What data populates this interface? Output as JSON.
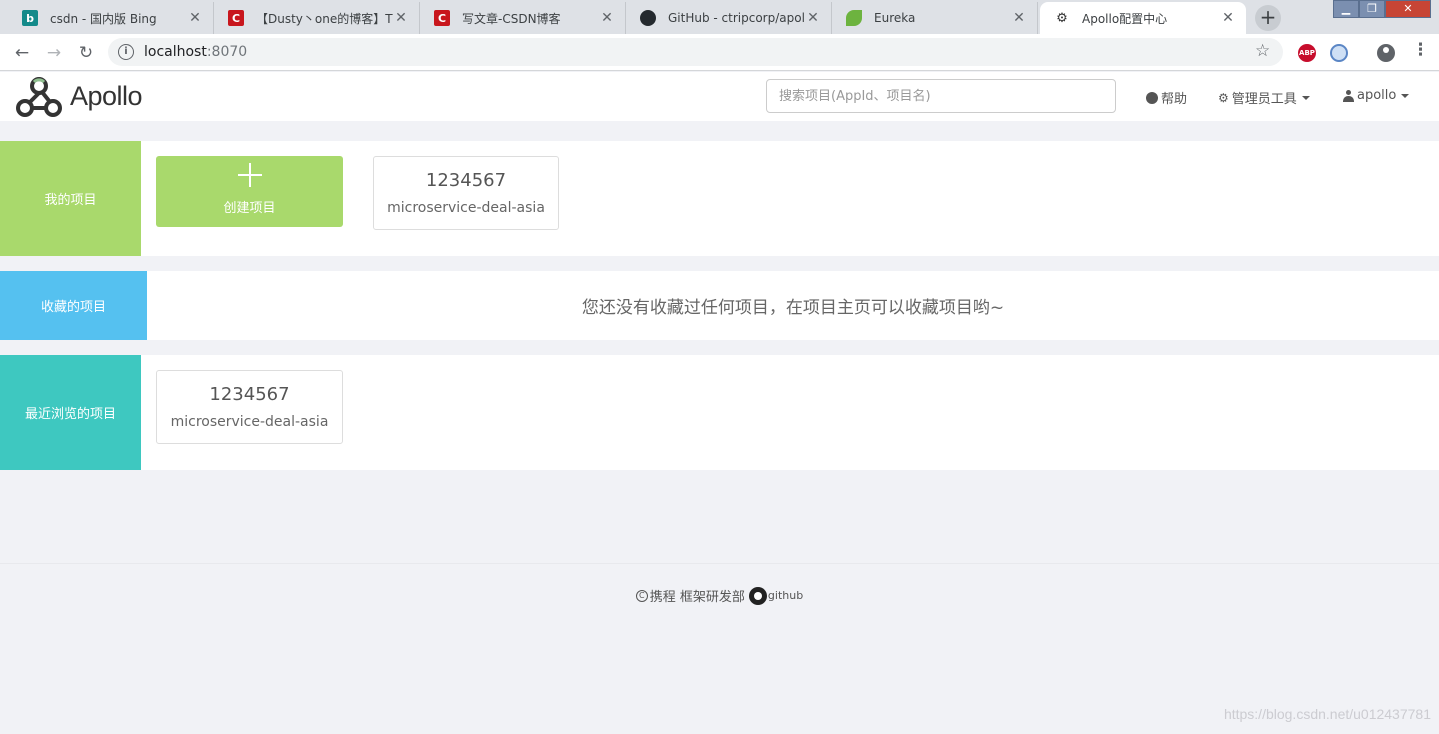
{
  "browser": {
    "tabs": [
      {
        "title": "csdn - 国内版 Bing",
        "icon": "bing-icon",
        "color": "#138a8a"
      },
      {
        "title": "【Dusty丶one的博客】Th",
        "icon": "csdn-icon",
        "color": "#c8161d"
      },
      {
        "title": "写文章-CSDN博客",
        "icon": "csdn-icon",
        "color": "#c8161d"
      },
      {
        "title": "GitHub - ctripcorp/apollo",
        "icon": "github-icon",
        "color": "#24292e"
      },
      {
        "title": "Eureka",
        "icon": "spring-leaf-icon",
        "color": "#6db33f"
      },
      {
        "title": "Apollo配置中心",
        "icon": "apollo-icon",
        "color": "#333333",
        "active": true
      }
    ],
    "address": {
      "host": "localhost",
      "port": ":8070"
    }
  },
  "header": {
    "logo_text": "Apollo",
    "search_placeholder": "搜索项目(AppId、项目名)",
    "help_label": "帮助",
    "admin_label": "管理员工具",
    "user_label": "apollo"
  },
  "my_projects": {
    "label": "我的项目",
    "label_color": "#a9d96c",
    "create_label": "创建项目",
    "apps": [
      {
        "appid": "1234567",
        "name": "microservice-deal-asia"
      }
    ]
  },
  "favorites": {
    "label": "收藏的项目",
    "label_color": "#55c1f0",
    "empty_message": "您还没有收藏过任何项目，在项目主页可以收藏项目哟~"
  },
  "recent": {
    "label": "最近浏览的项目",
    "label_color": "#3ec8c0",
    "apps": [
      {
        "appid": "1234567",
        "name": "microservice-deal-asia"
      }
    ]
  },
  "footer": {
    "copyright_text": "携程 框架研发部",
    "github_text": "github"
  },
  "watermark": "https://blog.csdn.net/u012437781"
}
